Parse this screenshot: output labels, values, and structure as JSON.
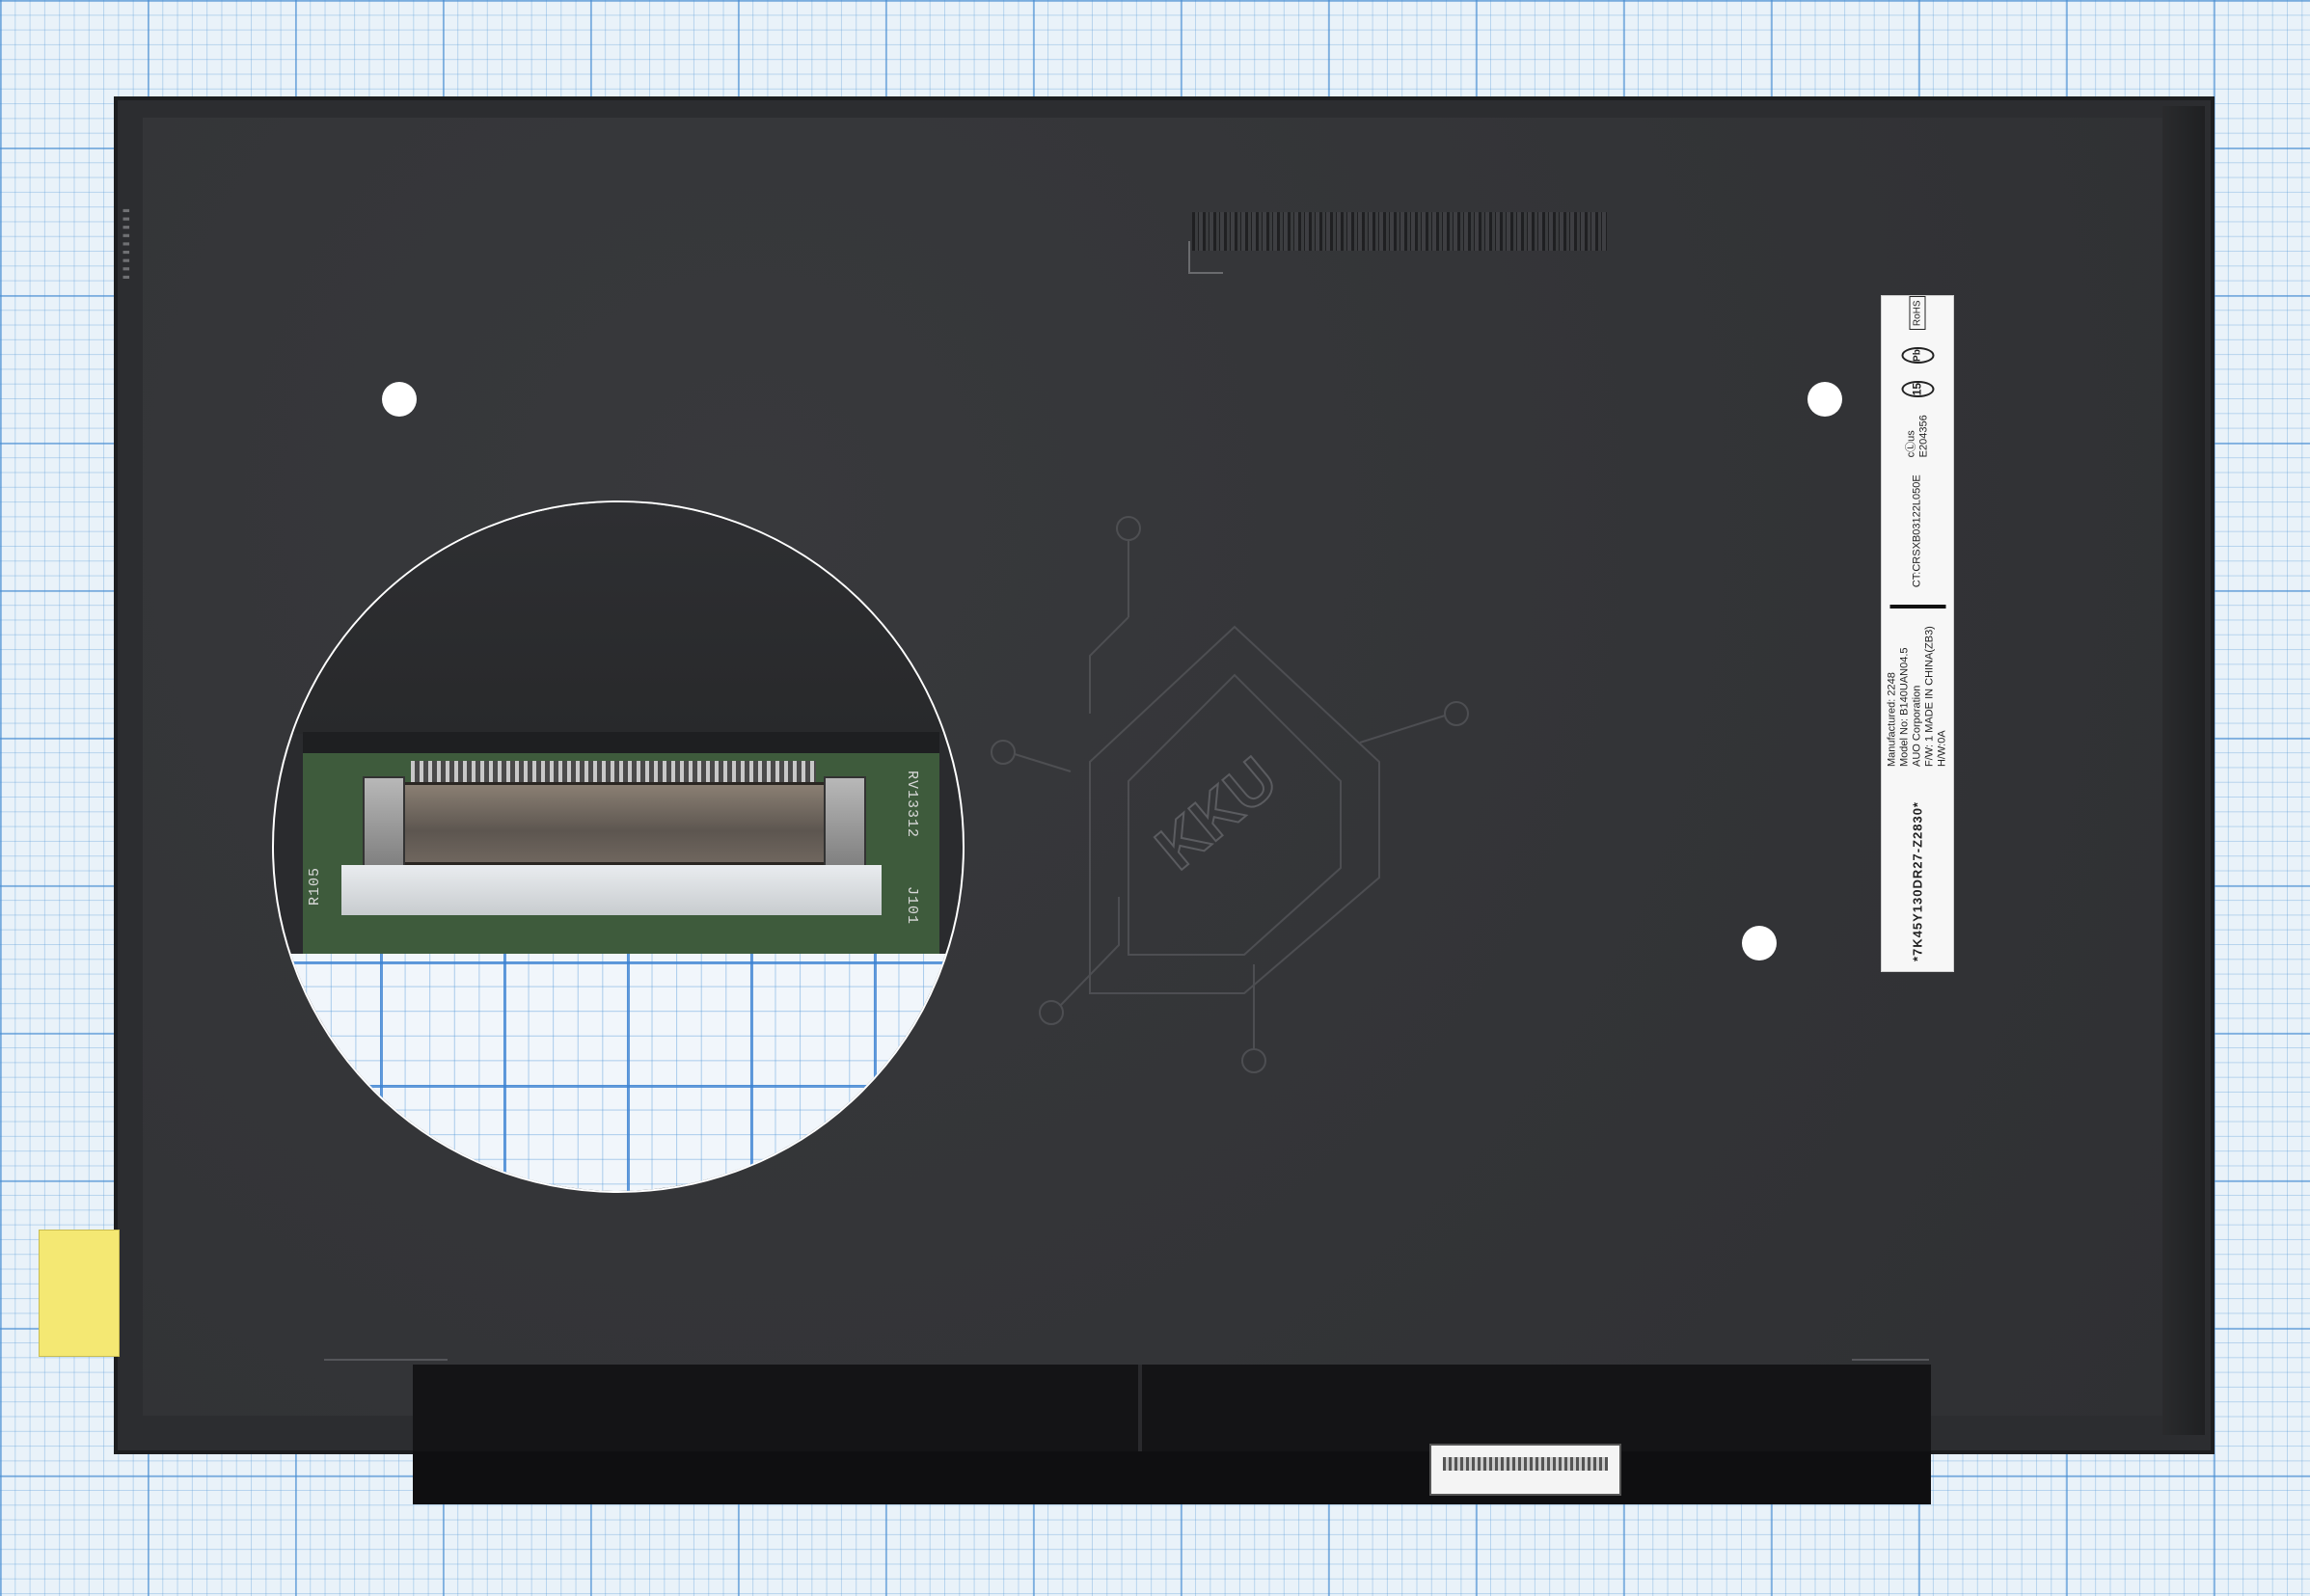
{
  "label": {
    "line1": "Manufactured: 2248",
    "line2": "Model No: B140UAN04.5",
    "line3": "AUO Corporation",
    "line4": "F/W: 1     MADE IN CHINA(ZB3)",
    "line5": "H/W:0A",
    "code_vertical": "CT:CRSXB03122L050E",
    "barcode_text": "*7K45Y130DR27-Z2830*",
    "ul_mark": "cⓁus",
    "ul_number": "E204356",
    "cert_15": "15",
    "rohs": "RoHS",
    "pb_mark": "Pb"
  },
  "zoom": {
    "silk_left": "R105",
    "silk_right": "RV13312",
    "silk_j": "J101"
  },
  "watermark": {
    "text": "KKU"
  },
  "colors": {
    "panel": "#2c2d30",
    "grid_line": "#468cd2",
    "label_bg": "#f7f7f7",
    "tape": "#f4e873"
  }
}
